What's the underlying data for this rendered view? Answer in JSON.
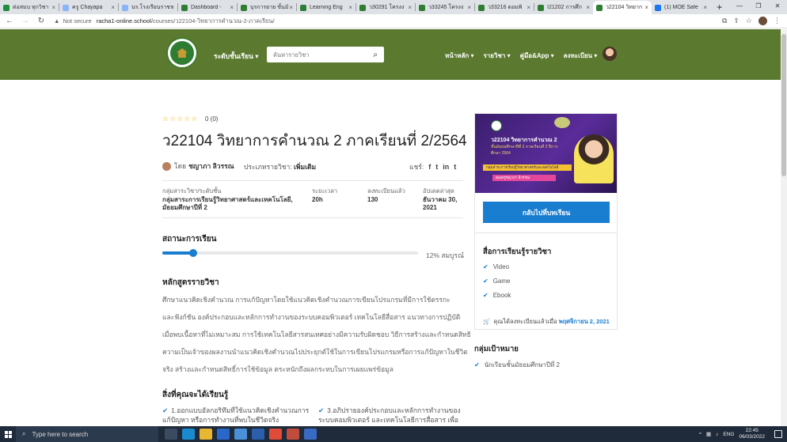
{
  "browser": {
    "tabs": [
      {
        "label": "ต่อสมบ ทุกวิชา",
        "color": "#1e8e3e"
      },
      {
        "label": "ครู Chayapa",
        "color": "#8ab4f8"
      },
      {
        "label": "นร.โรงเรียนราชา",
        "color": "#8ab4f8"
      },
      {
        "label": "Dashboard -",
        "color": "#2e7d32"
      },
      {
        "label": "บุรการยาย ขั้นมั",
        "color": "#2e7d32"
      },
      {
        "label": "Learning Eng",
        "color": "#2e7d32"
      },
      {
        "label": "ว30291 โครงง",
        "color": "#2e7d32"
      },
      {
        "label": "ว33245 โครงง",
        "color": "#2e7d32"
      },
      {
        "label": "ว33216 ดอมพิ",
        "color": "#2e7d32"
      },
      {
        "label": "I21202 การศึก",
        "color": "#2e7d32"
      },
      {
        "label": "ว22104 วิทยาก",
        "color": "#2e7d32",
        "active": true
      },
      {
        "label": "(1) MOE Safe",
        "color": "#1877f2"
      }
    ],
    "new_tab": "+",
    "not_secure": "Not secure",
    "url_host": "racha1-online.school",
    "url_path": "/courses/ว22104-วิทยาการคำนวณ-2-ภาคเรียน/"
  },
  "header": {
    "level_menu": "ระดับชั้นเรียน ▾",
    "search_placeholder": "ค้นหารายวิชา",
    "nav": [
      "หน้าหลัก ▾",
      "รายวิชา ▾",
      "คู่มือ&App ▾",
      "ลงทะเบียน ▾"
    ]
  },
  "course": {
    "stars": "☆☆☆☆☆",
    "rating": "0 (0)",
    "title": "ว22104 วิทยาการคำนวณ 2 ภาคเรียนที่ 2/2564",
    "by": "โดย",
    "author": "ชญาภา ลิวรรณ",
    "category_label": "ประเภทรายวิชา:",
    "category": "เพิ่มเติม",
    "share_label": "แชร์:",
    "share_icons": [
      "f",
      "t",
      "in",
      "t"
    ],
    "meta": {
      "group_label": "กลุ่มสาระวิชา/ระดับชั้น",
      "group_value": "กลุ่มสาระการเรียนรู้วิทยาศาสตร์และเทคโนโลยี, มัธยมศึกษาปีที่ 2",
      "duration_label": "ระยะเวลา",
      "duration_value": "20h",
      "enrolled_label": "ลงทะเบียนแล้ว",
      "enrolled_value": "130",
      "updated_label": "อัปเดตล่าสุด",
      "updated_value": "ธันวาคม 30, 2021"
    },
    "status_heading": "สถานะการเรียน",
    "progress_percent": 12,
    "progress_text": "12% สมบูรณ์",
    "curriculum_heading": "หลักสูตรรายวิชา",
    "description": [
      "ศึกษาแนวคิดเชิงคำนวณ การแก้ปัญหาโดยใช้แนวคิดเชิงคำนวณการเขียนโปรแกรมที่มีการใช้ตรรกะ",
      "และฟังก์ชัน องค์ประกอบและหลักการทำงานของระบบคอมพิวเตอร์ เทคโนโลยีสื่อสาร แนวทางการปฏิบัติ",
      "เมื่อพบเนื้อหาที่ไม่เหมาะสม การใช้เทคโนโลยีสารสนเทศอย่างมีความรับผิดชอบ วิธีการสร้างและกำหนดสิทธิ",
      "ความเป็นเจ้าของผลงานนำแนวคิดเชิงคำนวณไปประยุกต์ใช้ในการเขียนโปรแกรมหรือการแก้ปัญหาในชีวิต",
      "จริง สร้างและกำหนดสิทธิ์การใช้ข้อมูล ตระหนักถึงผลกระทบในการเผยแพร่ข้อมูล"
    ],
    "learn_heading": "สิ่งที่คุณจะได้เรียนรู้",
    "learn_items": [
      "1.ออกแบบอัลกอริทึมที่ใช้แนวคิดเชิงคำนวณการแก้ปัญหา หรือการทำงานที่พบในชีวิตจริง",
      "3.อภิปรายองค์ประกอบและหลักการทำงานของระบบคอมพิวเตอร์ และเทคโนโลยีการสื่อสาร เพื่อ"
    ]
  },
  "sidebar": {
    "banner_title": "ว22104 วิทยาการคำนวณ 2",
    "banner_sub": "ชั้นมัธยมศึกษาปีที่ 2 ภาคเรียนที่ 2 ปีการศึกษา 2564",
    "banner_stripe": "กลุ่มสาระการเรียนรู้วิทยาศาสตร์และเทคโนโลยี",
    "banner_teacher": "คุณครูชญาภา ลิวรรณ",
    "continue_button": "กลับไปที่บทเรียน",
    "materials_heading": "สื่อการเรียนรู้รายวิชา",
    "materials": [
      "Video",
      "Game",
      "Ebook"
    ],
    "enrolled_text": "คุณได้ลงทะเบียนแล้วเมื่อ",
    "enrolled_date": "พฤศจิกายน 2, 2021",
    "target_heading": "กลุ่มเป้าหมาย",
    "target_items": [
      "นักเรียนชั้นมัธยมศึกษาปีที่ 2"
    ]
  },
  "taskbar": {
    "search_text": "Type here to search",
    "lang": "ENG",
    "time": "22:45",
    "date": "06/03/2022"
  }
}
